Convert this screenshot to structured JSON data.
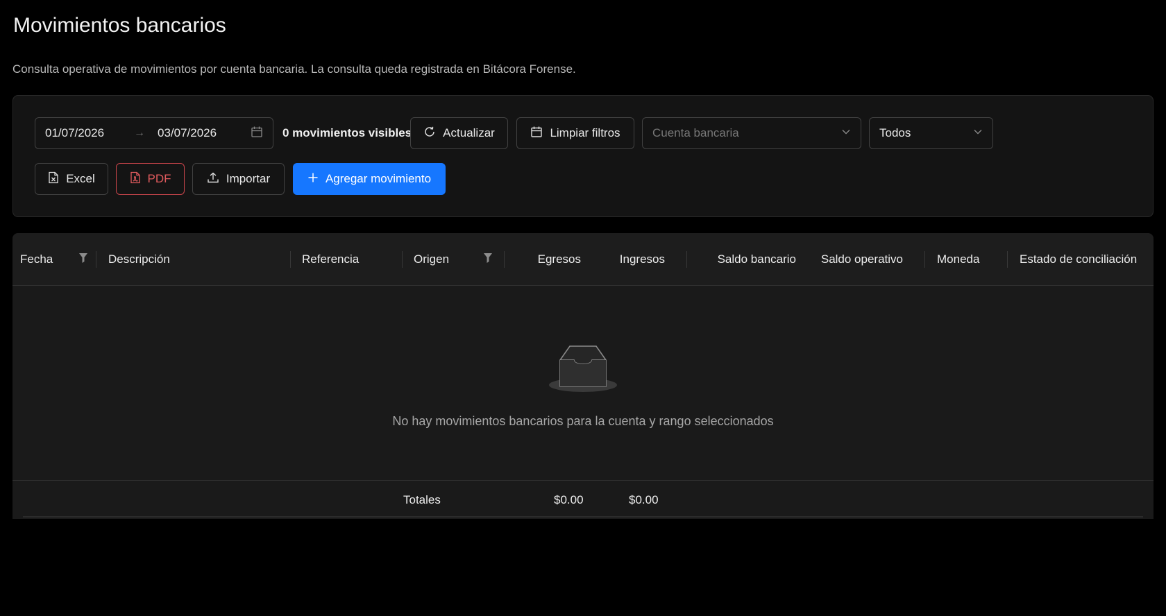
{
  "page": {
    "title": "Movimientos bancarios",
    "subtitle": "Consulta operativa de movimientos por cuenta bancaria. La consulta queda registrada en Bitácora Forense."
  },
  "filters": {
    "date_from": "01/07/2026",
    "date_separator": "→",
    "date_to": "03/07/2026",
    "visible_count": "0 movimientos visibles",
    "refresh_label": "Actualizar",
    "clear_label": "Limpiar filtros",
    "account_placeholder": "Cuenta bancaria",
    "status_value": "Todos"
  },
  "actions": {
    "excel_label": "Excel",
    "pdf_label": "PDF",
    "import_label": "Importar",
    "add_label": "Agregar movimiento"
  },
  "table": {
    "columns": {
      "fecha": "Fecha",
      "descripcion": "Descripción",
      "referencia": "Referencia",
      "origen": "Origen",
      "egresos": "Egresos",
      "ingresos": "Ingresos",
      "saldo_bancario": "Saldo bancario",
      "saldo_operativo": "Saldo operativo",
      "moneda": "Moneda",
      "estado": "Estado de conciliación"
    },
    "empty_message": "No hay movimientos bancarios para la cuenta y rango seleccionados",
    "totals": {
      "label": "Totales",
      "egresos": "$0.00",
      "ingresos": "$0.00"
    }
  },
  "icons": {
    "calendar": "calendar-icon",
    "refresh": "reload-icon",
    "clear": "calendar-clear-icon",
    "chevron": "chevron-down-icon",
    "excel": "file-excel-icon",
    "pdf": "file-pdf-icon",
    "import": "upload-icon",
    "add": "plus-icon",
    "filter": "filter-icon",
    "empty": "empty-inbox-icon"
  },
  "colors": {
    "background": "#000000",
    "panel": "#141414",
    "primary": "#1677ff",
    "danger": "#e25b5e"
  }
}
